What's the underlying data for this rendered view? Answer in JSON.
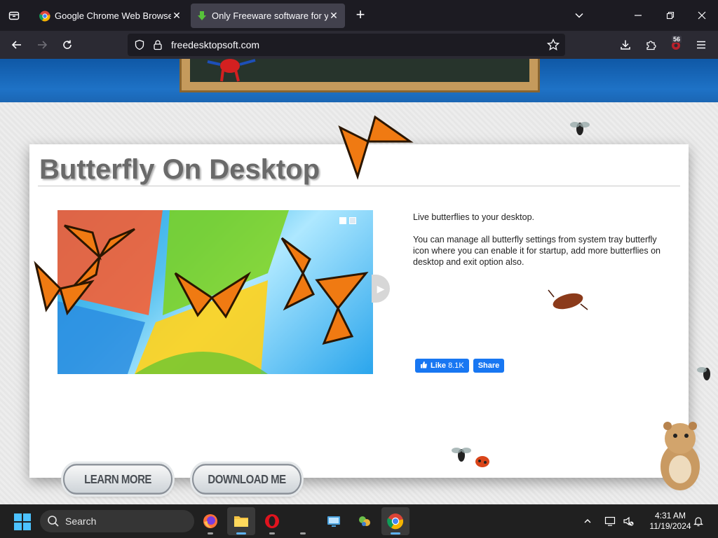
{
  "tabs": [
    {
      "title": "Google Chrome Web Browser",
      "close": "✕",
      "active": false
    },
    {
      "title": "Only Freeware software for you",
      "close": "✕",
      "active": true
    }
  ],
  "new_tab": "+",
  "navbar": {
    "url": "freedesktopsoft.com",
    "extensions_badge": "56"
  },
  "page": {
    "title": "Butterfly On Desktop",
    "description": [
      "Live butterflies to your desktop.",
      "You can manage all butterfly settings from system tray butterfly icon where you can enable it for startup, add more butterflies on desktop and exit option also."
    ],
    "facebook": {
      "like_label": "Like",
      "like_count": "8.1K",
      "share_label": "Share"
    },
    "buttons": {
      "learn_more": "LEARN MORE",
      "download": "DOWNLOAD ME"
    }
  },
  "taskbar": {
    "search_label": "Search",
    "time": "4:31 AM",
    "date": "11/19/2024"
  },
  "colors": {
    "butterfly_orange": "#f07a12",
    "accent_blue": "#1877f2",
    "banner_blue": "#1565b8"
  }
}
